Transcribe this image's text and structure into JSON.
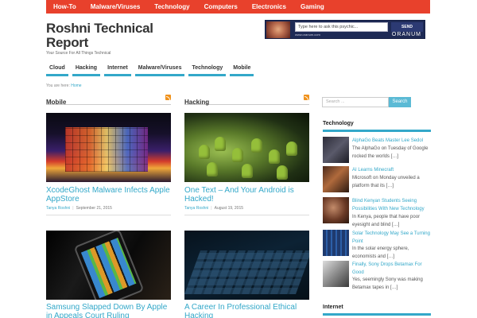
{
  "topnav": [
    "How-To",
    "Malware/Viruses",
    "Technology",
    "Computers",
    "Electronics",
    "Gaming"
  ],
  "site": {
    "title": "Roshni Technical Report",
    "tagline": "Your Source For All Things Technical"
  },
  "ad": {
    "placeholder": "Type here to ask this psychic...",
    "send": "SEND",
    "url": "www.oranum.com",
    "brand": "ORANUM"
  },
  "subnav": [
    "Cloud",
    "Hacking",
    "Internet",
    "Malware/Viruses",
    "Technology",
    "Mobile"
  ],
  "breadcrumb": {
    "prefix": "You are here:",
    "link": "Home"
  },
  "columns": [
    {
      "heading": "Mobile",
      "posts": [
        {
          "title": "XcodeGhost Malware Infects Apple AppStore",
          "author": "Tanya Roshni",
          "date": "September 21, 2015"
        },
        {
          "title": "Samsung Slapped Down By Apple in Appeals Court Ruling",
          "author": "",
          "date": ""
        }
      ]
    },
    {
      "heading": "Hacking",
      "posts": [
        {
          "title": "One Text – And Your Android is Hacked!",
          "author": "Tanya Roshni",
          "date": "August 19, 2015"
        },
        {
          "title": "A Career In Professional Ethical Hacking",
          "author": "",
          "date": ""
        }
      ]
    }
  ],
  "sidebar": {
    "search_placeholder": "Search ...",
    "search_button": "Search",
    "technology_heading": "Technology",
    "items": [
      {
        "title": "AlphaGo Beats Master Lee Sedol",
        "excerpt": "The AlphaGo on Tuesday of Google rocked the worlds […]"
      },
      {
        "title": "AI Learns Minecraft",
        "excerpt": "Microsoft on Monday unveiled a platform that its […]"
      },
      {
        "title": "Blind Kenyan Students Seeing Possibilities With New Technology",
        "excerpt": "In Kenya, people that have poor eyesight and blind […]"
      },
      {
        "title": "Solar Technology May See a Turning Point",
        "excerpt": "In the solar energy sphere, economists and […]"
      },
      {
        "title": "Finally, Sony Drops Betamax For Good",
        "excerpt": "Yes, seemingly Sony was making Betamax tapes in […]"
      }
    ],
    "internet_heading": "Internet"
  }
}
